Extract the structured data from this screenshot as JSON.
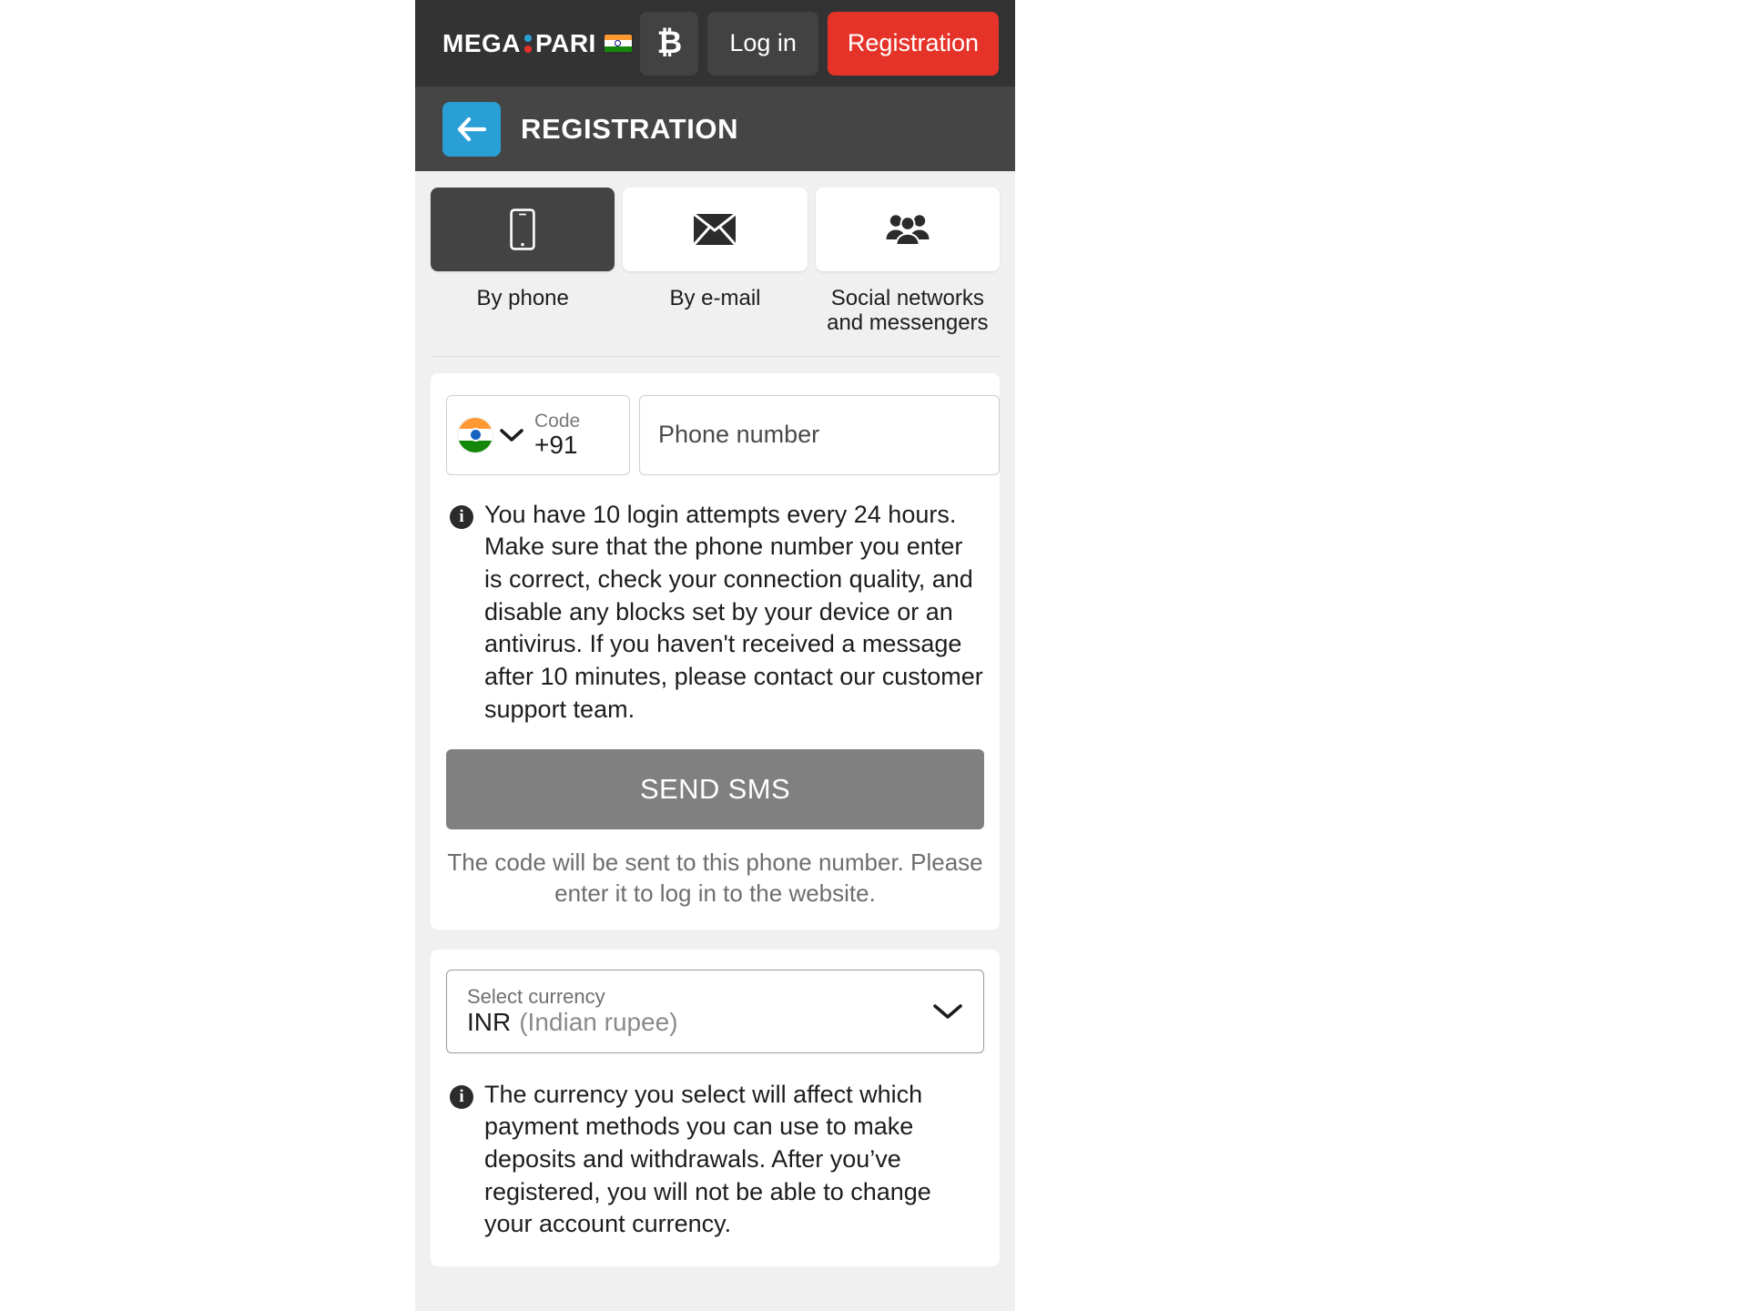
{
  "header": {
    "logo_text_left": "MEGA",
    "logo_text_right": "PARI",
    "flag_icon": "india-flag-icon",
    "bitcoin_icon": "bitcoin-icon",
    "bitcoin_symbol": "₿",
    "login_label": "Log in",
    "registration_label": "Registration",
    "registration_color": "#e63329"
  },
  "titlebar": {
    "back_icon": "arrow-left-icon",
    "back_color": "#2a9fd6",
    "title": "REGISTRATION"
  },
  "tabs": [
    {
      "label": "By phone",
      "icon": "mobile-phone-icon",
      "active": true
    },
    {
      "label": "By e-mail",
      "icon": "envelope-icon",
      "active": false
    },
    {
      "label": "Social networks and messengers",
      "icon": "people-group-icon",
      "active": false
    }
  ],
  "phone_form": {
    "code_label": "Code",
    "code_value": "+91",
    "code_flag_icon": "india-flag-circle-icon",
    "code_chevron_icon": "chevron-down-icon",
    "phone_placeholder": "Phone number",
    "phone_value": "",
    "info_icon": "info-icon",
    "info_text": "You have 10 login attempts every 24 hours. Make sure that the phone number you enter is correct, check your connection quality, and disable any blocks set by your device or an antivirus. If you haven't received a message after 10 minutes, please contact our customer support team.",
    "send_sms_label": "SEND SMS",
    "send_sms_color": "#808080",
    "hint_text": "The code will be sent to this phone number. Please enter it to log in to the website."
  },
  "currency_form": {
    "select_label": "Select currency",
    "select_value": "INR",
    "select_value_sub": "(Indian rupee)",
    "select_chevron_icon": "chevron-down-icon",
    "info_icon": "info-icon",
    "info_text": "The currency you select will affect which payment methods you can use to make deposits and withdrawals. After you’ve registered, you will not be able to change your account currency."
  }
}
